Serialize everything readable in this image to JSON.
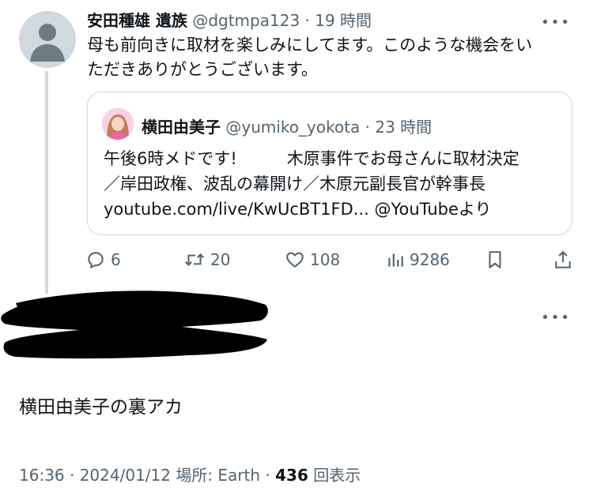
{
  "tweet": {
    "author_name": "安田種雄 遺族",
    "handle": "@dgtmpa123",
    "separator": "·",
    "time": "19 時間",
    "text_line1": "母も前向きに取材を楽しみにしてます。このような機会をい",
    "text_line2": "ただきありがとうございます。"
  },
  "quote": {
    "author_name": "横田由美子",
    "handle": "@yumiko_yokota",
    "separator": "·",
    "time": "23 時間",
    "line1": "午後6時メドです!　　　木原事件でお母さんに取材決定",
    "line2": "／岸田政権、波乱の幕開け／木原元副長官が幹事長",
    "line3": "youtube.com/live/KwUcBT1FD... @YouTubeより"
  },
  "actions": {
    "replies": "6",
    "retweets": "20",
    "likes": "108",
    "views": "9286"
  },
  "reply": {
    "more": "•••",
    "text": "横田由美子の裏アカ",
    "meta_prefix": "16:36 · 2024/01/12 場所: Earth · ",
    "view_count": "436",
    "view_suffix": " 回表示"
  },
  "top_more": "•••",
  "icons": [
    "more-icon",
    "reply-icon",
    "retweet-icon",
    "like-icon",
    "views-icon",
    "bookmark-icon",
    "share-icon"
  ],
  "colors": {
    "muted": "#536471",
    "border": "#cfd9de",
    "text": "#0f1419"
  }
}
